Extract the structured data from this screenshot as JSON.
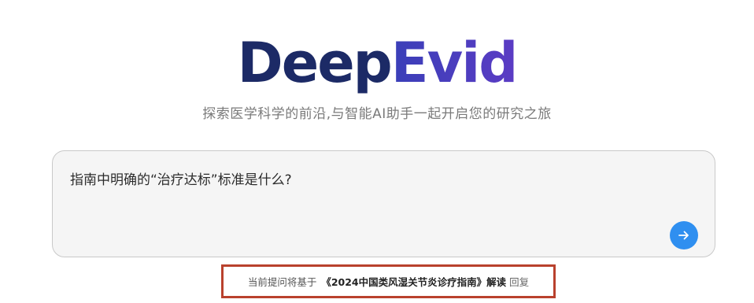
{
  "brand": {
    "logo_part1": "Deep",
    "logo_part2": "Evid",
    "colors": {
      "deep": "#1c2a66",
      "evid": "#4b3cc0"
    }
  },
  "subtitle": "探索医学科学的前沿,与智能AI助手一起开启您的研究之旅",
  "chat": {
    "query": "指南中明确的“治疗达标”标准是什么?",
    "send_icon": "arrow-right-icon",
    "send_color": "#2f8ff0"
  },
  "notice": {
    "prefix": "当前提问将基于",
    "book": "《2024中国类风湿关节炎诊疗指南》解读",
    "suffix": "回复",
    "highlight_color": "#b9412d"
  }
}
